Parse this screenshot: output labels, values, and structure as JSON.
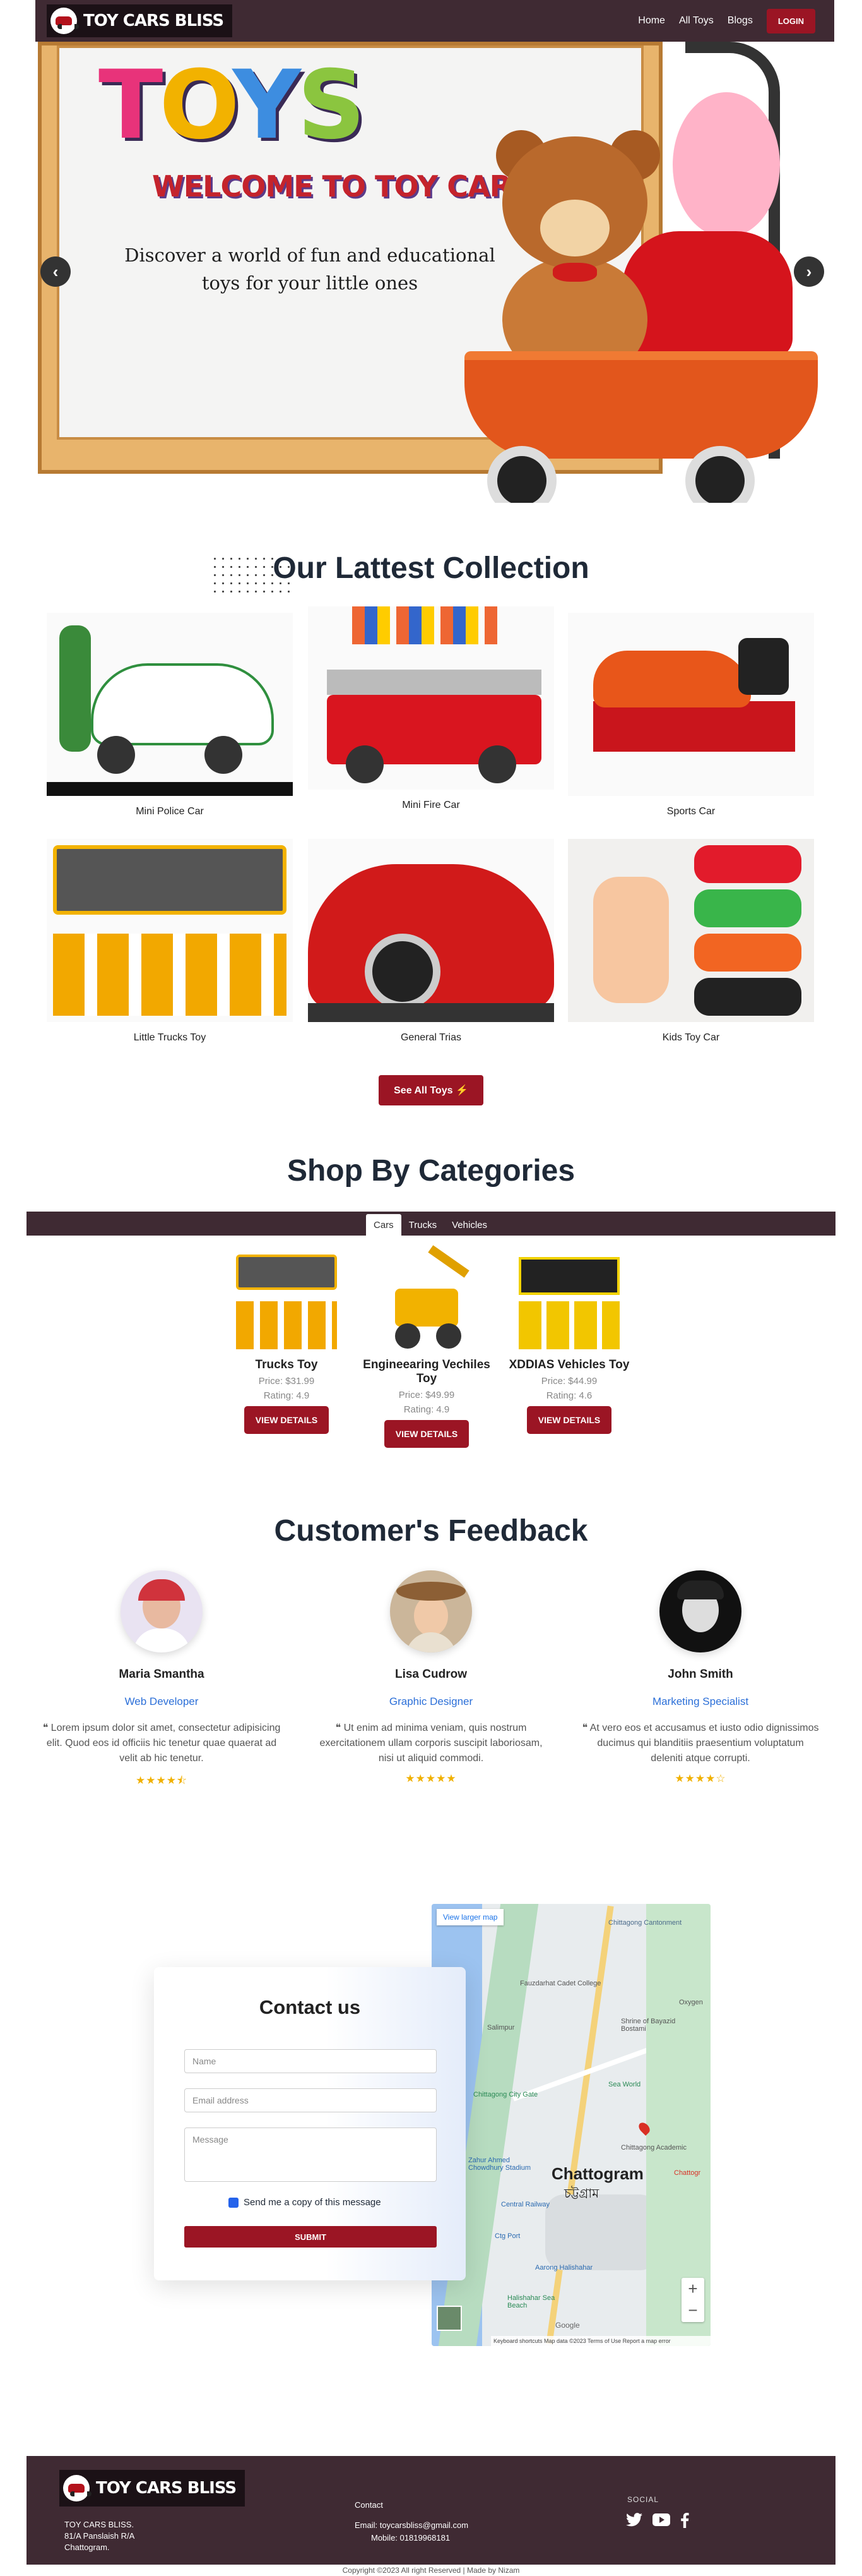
{
  "nav": {
    "brand": "TOY CARS BLISS",
    "links": [
      "Home",
      "All Toys",
      "Blogs"
    ],
    "login": "LOGIN"
  },
  "hero": {
    "title_letters": [
      "T",
      "O",
      "Y",
      "S"
    ],
    "title_colors": [
      "#e8337a",
      "#f2b200",
      "#3d8de0",
      "#8bc53f"
    ],
    "welcome": "WELCOME TO TOY CARS BLISS!",
    "subtitle": "Discover a world of fun and educational toys for your little ones",
    "prev": "‹",
    "next": "›"
  },
  "latest": {
    "title": "Our Lattest Collection",
    "items": [
      "Mini Police Car",
      "Mini Fire Car",
      "Sports Car",
      "Little Trucks Toy",
      "General Trias",
      "Kids Toy Car"
    ],
    "see_all": "See All Toys ⚡"
  },
  "categories": {
    "title": "Shop By Categories",
    "tabs": [
      "Cars",
      "Trucks",
      "Vehicles"
    ],
    "products": [
      {
        "name": "Trucks Toy",
        "price": "Price: $31.99",
        "rating": "Rating: 4.9"
      },
      {
        "name": "Engineearing Vechiles Toy",
        "price": "Price: $49.99",
        "rating": "Rating: 4.9"
      },
      {
        "name": "XDDIAS Vehicles Toy",
        "price": "Price: $44.99",
        "rating": "Rating: 4.6"
      }
    ],
    "button": "VIEW DETAILS"
  },
  "feedback": {
    "title": "Customer's Feedback",
    "items": [
      {
        "name": "Maria Smantha",
        "role": "Web Developer",
        "text": "❝ Lorem ipsum dolor sit amet, consectetur adipisicing elit. Quod eos id officiis hic tenetur quae quaerat ad velit ab hic tenetur.",
        "stars": "★★★★⯪"
      },
      {
        "name": "Lisa Cudrow",
        "role": "Graphic Designer",
        "text": "❝ Ut enim ad minima veniam, quis nostrum exercitationem ullam corporis suscipit laboriosam, nisi ut aliquid commodi.",
        "stars": "★★★★★"
      },
      {
        "name": "John Smith",
        "role": "Marketing Specialist",
        "text": "❝ At vero eos et accusamus et iusto odio dignissimos ducimus qui blanditiis praesentium voluptatum deleniti atque corrupti.",
        "stars": "★★★★☆"
      }
    ]
  },
  "contact": {
    "title": "Contact us",
    "name_placeholder": "Name",
    "email_placeholder": "Email address",
    "message_placeholder": "Message",
    "copy_label": "Send me a copy of this message",
    "submit": "SUBMIT"
  },
  "map": {
    "view_larger": "View larger map",
    "city": "Chattogram",
    "city_local": "চট্টগ্রাম",
    "labels": [
      "Chittagong Cantonment",
      "Fauzdarhat Cadet College",
      "Salimpur",
      "Shrine of Bayazid Bostami",
      "Oxygen",
      "Chittagong City Gate",
      "Sea World",
      "Zahur Ahmed Chowdhury Stadium",
      "Chittagong Academic",
      "Central Railway",
      "Ctg Port",
      "Aarong Halishahar",
      "Halishahar Sea Beach",
      "Chattogr"
    ],
    "footer": "Keyboard shortcuts   Map data ©2023   Terms of Use   Report a map error",
    "google": "Google"
  },
  "footer": {
    "brand": "TOY CARS BLISS",
    "address": [
      "TOY CARS BLISS.",
      "81/A Panslaish R/A",
      "Chattogram."
    ],
    "contact_title": "Contact",
    "email": "Email: toycarsbliss@gmail.com",
    "mobile": "Mobile: 01819968181",
    "social_title": "SOCIAL",
    "copyright": "Copyright ©2023 All right Reserved | Made by Nizam"
  },
  "colors": {
    "primary": "#9b1524",
    "dark": "#3f2a33",
    "link": "#2b6fd8",
    "star": "#f0b000"
  }
}
